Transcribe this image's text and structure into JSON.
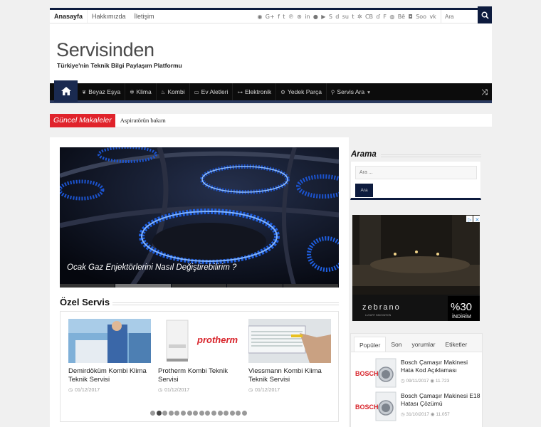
{
  "topnav": {
    "items": [
      "Anasayfa",
      "Hakkımızda",
      "İletişim"
    ],
    "search_placeholder": "Ara"
  },
  "social_icons": [
    "rss-icon",
    "google-plus-icon",
    "facebook-icon",
    "twitter-icon",
    "pinterest-icon",
    "dribbble-icon",
    "linkedin-icon",
    "flickr-icon",
    "youtube-icon",
    "skype-icon",
    "digg-icon",
    "stumbleupon-icon",
    "tumblr-icon",
    "yelp-icon",
    "lastfm-icon",
    "deviantart-icon",
    "foursquare-icon",
    "github-icon",
    "behance-icon",
    "instagram-icon",
    "soundcloud-icon",
    "vk-icon"
  ],
  "social_labels": {
    "lastfm": "CB",
    "behance": "Bē",
    "soundcloud": "Soo"
  },
  "header": {
    "logo": "Servisinden",
    "tagline": "Türkiye'nin Teknik Bilgi Paylaşım Platformu"
  },
  "mainnav": {
    "items": [
      {
        "label": "Beyaz Eşya",
        "icon": "leaf-icon"
      },
      {
        "label": "Klima",
        "icon": "snowflake-icon"
      },
      {
        "label": "Kombi",
        "icon": "fire-icon"
      },
      {
        "label": "Ev Aletleri",
        "icon": "tv-icon"
      },
      {
        "label": "Elektronik",
        "icon": "circuit-icon"
      },
      {
        "label": "Yedek Parça",
        "icon": "gear-icon"
      },
      {
        "label": "Servis Ara",
        "icon": "map-pin-icon",
        "dropdown": true
      }
    ]
  },
  "breaking": {
    "label": "Güncel Makaleler",
    "text": "Aspiratörün bakım"
  },
  "slider": {
    "caption": "Ocak Gaz Enjektörlerini Nasıl Değiştirebilirim ?"
  },
  "ozel_servis": {
    "title": "Özel Servis",
    "cards": [
      {
        "title": "Demirdöküm Kombi Klima Teknik Servisi",
        "date": "01/12/2017"
      },
      {
        "title": "Protherm Kombi Teknik Servisi",
        "date": "01/12/2017",
        "brand": "protherm"
      },
      {
        "title": "Viessmann Kombi Klima Teknik Servisi",
        "date": "01/12/2017"
      }
    ]
  },
  "sidebar": {
    "search_title": "Arama",
    "search_placeholder": "Ara ...",
    "search_button": "Ara",
    "ad": {
      "brand": "zebrano",
      "sub": "LUXURY INNOVATION",
      "percent": "%30",
      "discount": "İNDİRİM"
    },
    "tabs": [
      "Popüler",
      "Son",
      "yorumlar",
      "Etiketler"
    ],
    "popular": [
      {
        "title": "Bosch Çamaşır Makinesi Hata Kod Açıklaması",
        "date": "09/11/2017",
        "views": "11.723",
        "brand": "BOSCH"
      },
      {
        "title": "Bosch Çamaşır Makinesi E18 Hatası Çözümü",
        "date": "31/10/2017",
        "views": "11.057",
        "brand": "BOSCH"
      }
    ]
  },
  "colors": {
    "navy": "#0d1b3e",
    "red": "#e0232b",
    "dark": "#0c0c0c"
  }
}
